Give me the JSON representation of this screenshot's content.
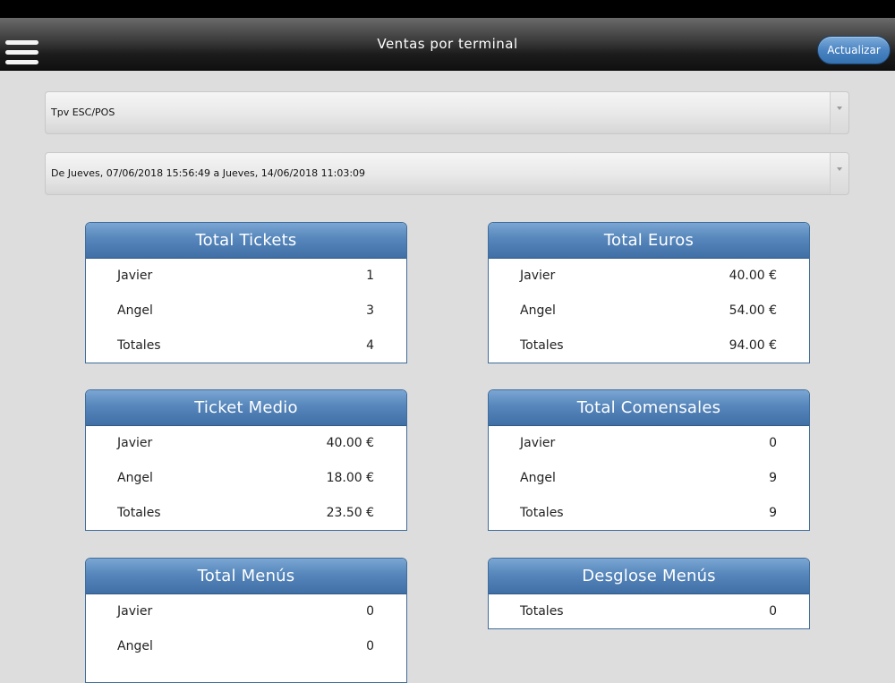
{
  "nav": {
    "title": "Ventas por terminal",
    "refresh_label": "Actualizar"
  },
  "filters": {
    "terminal": "Tpv ESC/POS",
    "date_range": "De Jueves, 07/06/2018 15:56:49 a Jueves, 14/06/2018 11:03:09"
  },
  "cards": {
    "total_tickets": {
      "title": "Total Tickets",
      "rows": [
        {
          "label": "Javier",
          "value": "1"
        },
        {
          "label": "Angel",
          "value": "3"
        },
        {
          "label": "Totales",
          "value": "4"
        }
      ]
    },
    "total_euros": {
      "title": "Total Euros",
      "rows": [
        {
          "label": "Javier",
          "value": "40.00 €"
        },
        {
          "label": "Angel",
          "value": "54.00 €"
        },
        {
          "label": "Totales",
          "value": "94.00 €"
        }
      ]
    },
    "ticket_medio": {
      "title": "Ticket Medio",
      "rows": [
        {
          "label": "Javier",
          "value": "40.00 €"
        },
        {
          "label": "Angel",
          "value": "18.00 €"
        },
        {
          "label": "Totales",
          "value": "23.50 €"
        }
      ]
    },
    "total_comensales": {
      "title": "Total Comensales",
      "rows": [
        {
          "label": "Javier",
          "value": "0"
        },
        {
          "label": "Angel",
          "value": "9"
        },
        {
          "label": "Totales",
          "value": "9"
        }
      ]
    },
    "total_menus": {
      "title": "Total Menús",
      "rows": [
        {
          "label": "Javier",
          "value": "0"
        },
        {
          "label": "Angel",
          "value": "0"
        }
      ]
    },
    "desglose_menus": {
      "title": "Desglose Menús",
      "rows": [
        {
          "label": "Totales",
          "value": "0"
        }
      ]
    }
  },
  "colors": {
    "card_header": "#5686bb",
    "refresh_button": "#4a84c2",
    "background": "#dddddd"
  },
  "icons": {
    "menu": "hamburger-menu-icon",
    "dropdown": "chevron-down-icon"
  }
}
